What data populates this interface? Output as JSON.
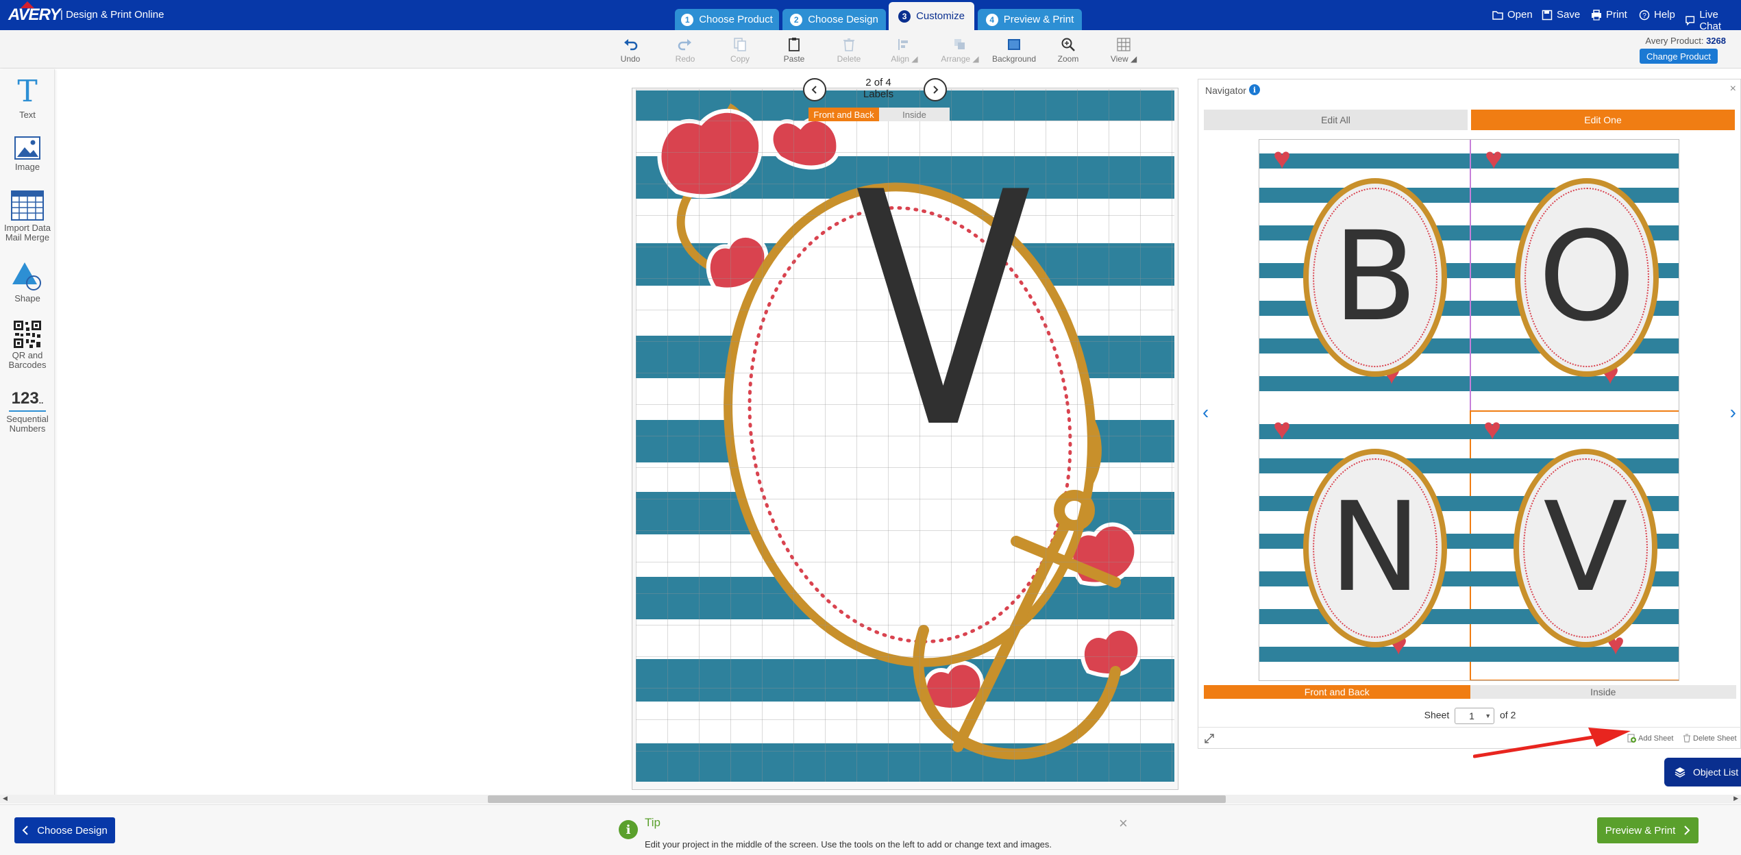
{
  "header": {
    "logo": "AVERY",
    "app_title": "Design & Print Online",
    "steps": [
      {
        "num": "1",
        "label": "Choose Product"
      },
      {
        "num": "2",
        "label": "Choose Design"
      },
      {
        "num": "3",
        "label": "Customize"
      },
      {
        "num": "4",
        "label": "Preview & Print"
      }
    ],
    "actions": {
      "open": "Open",
      "save": "Save",
      "print": "Print",
      "help": "Help",
      "live_chat": "Live Chat"
    }
  },
  "toolbar": {
    "undo": "Undo",
    "redo": "Redo",
    "copy": "Copy",
    "paste": "Paste",
    "delete": "Delete",
    "align": "Align",
    "arrange": "Arrange",
    "background": "Background",
    "zoom": "Zoom",
    "view": "View",
    "product_label": "Avery Product:",
    "product_number": "3268",
    "change_product": "Change Product"
  },
  "left_panel": {
    "text": "Text",
    "image": "Image",
    "import_data": "Import Data",
    "mail_merge": "Mail Merge",
    "shape": "Shape",
    "qr_line1": "QR and",
    "qr_line2": "Barcodes",
    "seq_glyph": "123",
    "seq_line1": "Sequential",
    "seq_line2": "Numbers"
  },
  "canvas": {
    "page_count": "2 of 4",
    "page_unit": "Labels",
    "front_back": "Front and Back",
    "inside": "Inside",
    "letter": "V"
  },
  "navigator": {
    "title": "Navigator",
    "edit_all": "Edit All",
    "edit_one": "Edit One",
    "letters": [
      "B",
      "O",
      "N",
      "V"
    ],
    "front_back": "Front and Back",
    "inside": "Inside",
    "sheet_label": "Sheet",
    "sheet_value": "1",
    "sheet_of": "of 2",
    "add_sheet": "Add Sheet",
    "delete_sheet": "Delete Sheet"
  },
  "object_list": "Object List",
  "footer": {
    "choose_design": "Choose Design",
    "tip_title": "Tip",
    "tip_text": "Edit your project in the middle of the screen. Use the tools on the left to add or change text and images.",
    "preview_print": "Preview & Print"
  },
  "colors": {
    "brand_blue": "#0738a8",
    "accent_orange": "#f07d13",
    "stripe_teal": "#2e819c",
    "green": "#5aa02c"
  }
}
